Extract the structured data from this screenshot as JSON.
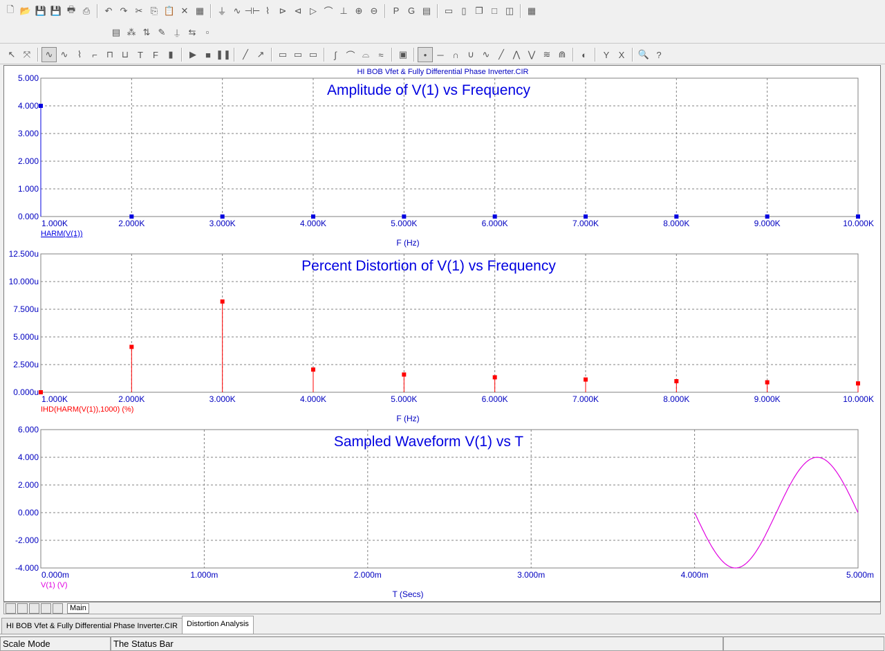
{
  "toolbar": {
    "row1": [
      "new-file",
      "open-file",
      "save",
      "save-all",
      "print",
      "print-preview",
      "undo",
      "redo",
      "cut",
      "copy",
      "paste",
      "delete",
      "select-all",
      "ground",
      "sine-source",
      "capacitor",
      "resistor",
      "diode",
      "transistor",
      "opamp",
      "inductor",
      "battery",
      "npn",
      "pnp",
      "P",
      "G",
      "component-window",
      "tile-horizontal",
      "tile-vertical",
      "cascade",
      "window",
      "split",
      "calculator"
    ],
    "row2": [
      "grid-text",
      "grid-graphics",
      "pin-connection",
      "pen",
      "label",
      "bus",
      "pin"
    ],
    "row3": [
      "select-mode",
      "zoom-mode",
      "scale-mode",
      "cursor-mode",
      "peak",
      "valley",
      "hi",
      "lo",
      "text",
      "fo",
      "graph",
      "run",
      "stop",
      "pause",
      "tangent",
      "slope",
      "wire",
      "bold-wire",
      "dotted",
      "step",
      "rise",
      "fall",
      "spike",
      "data-points",
      "token",
      "band",
      "wave1",
      "wave2",
      "wave3",
      "wave4",
      "wave5",
      "wave6",
      "wave7",
      "wave8",
      "color",
      "same-y",
      "same-x",
      "find",
      "help"
    ]
  },
  "window_title": "HI BOB Vfet & Fully Differential Phase Inverter.CIR",
  "plots": [
    {
      "title": "Amplitude of V(1) vs Frequency",
      "xlabel": "F (Hz)",
      "trace_label": "HARM(V(1))",
      "color": "#0000e0",
      "yticks": [
        "0.000",
        "1.000",
        "2.000",
        "3.000",
        "4.000",
        "5.000"
      ],
      "xticks": [
        "1.000K",
        "2.000K",
        "3.000K",
        "4.000K",
        "5.000K",
        "6.000K",
        "7.000K",
        "8.000K",
        "9.000K",
        "10.000K"
      ]
    },
    {
      "title": "Percent Distortion of V(1) vs Frequency",
      "xlabel": "F (Hz)",
      "trace_label": "IHD(HARM(V(1)),1000) (%)",
      "color": "#ff0000",
      "yticks": [
        "0.000u",
        "2.500u",
        "5.000u",
        "7.500u",
        "10.000u",
        "12.500u"
      ],
      "xticks": [
        "1.000K",
        "2.000K",
        "3.000K",
        "4.000K",
        "5.000K",
        "6.000K",
        "7.000K",
        "8.000K",
        "9.000K",
        "10.000K"
      ]
    },
    {
      "title": "Sampled Waveform  V(1) vs T",
      "xlabel": "T (Secs)",
      "trace_label": "V(1) (V)",
      "color": "#e000e0",
      "yticks": [
        "-4.000",
        "-2.000",
        "0.000",
        "2.000",
        "4.000",
        "6.000"
      ],
      "xticks": [
        "0.000m",
        "1.000m",
        "2.000m",
        "3.000m",
        "4.000m",
        "5.000m"
      ]
    }
  ],
  "chart_data": [
    {
      "type": "bar",
      "title": "Amplitude of V(1) vs Frequency",
      "xlabel": "F (Hz)",
      "series": [
        {
          "name": "HARM(V(1))",
          "x": [
            1000,
            2000,
            3000,
            4000,
            5000,
            6000,
            7000,
            8000,
            9000,
            10000
          ],
          "values": [
            4.0,
            0.0,
            0.0,
            0.0,
            0.0,
            0.0,
            0.0,
            0.0,
            0.0,
            0.0
          ]
        }
      ],
      "xlim": [
        1000,
        10000
      ],
      "ylim": [
        0,
        5
      ],
      "grid": true
    },
    {
      "type": "bar",
      "title": "Percent Distortion of V(1) vs Frequency",
      "xlabel": "F (Hz)",
      "series": [
        {
          "name": "IHD(HARM(V(1)),1000) (%)",
          "x": [
            1000,
            2000,
            3000,
            4000,
            5000,
            6000,
            7000,
            8000,
            9000,
            10000
          ],
          "values": [
            0.0,
            4.1,
            8.2,
            2.05,
            1.6,
            1.35,
            1.15,
            1.0,
            0.9,
            0.8
          ]
        }
      ],
      "xlim": [
        1000,
        10000
      ],
      "ylim": [
        0,
        12.5
      ],
      "y_unit": "u",
      "grid": true
    },
    {
      "type": "line",
      "title": "Sampled Waveform  V(1) vs T",
      "xlabel": "T (Secs)",
      "series": [
        {
          "name": "V(1) (V)",
          "x": [
            4.0,
            4.125,
            4.25,
            4.375,
            4.5,
            4.625,
            4.75,
            4.875,
            5.0
          ],
          "values": [
            0.0,
            -2.83,
            -4.0,
            -2.83,
            0.0,
            2.83,
            4.0,
            2.83,
            0.0
          ]
        }
      ],
      "x_unit": "m",
      "xlim": [
        0,
        5
      ],
      "ylim": [
        -4,
        6
      ],
      "grid": true
    }
  ],
  "bottom": {
    "page_tab": "Main"
  },
  "doc_tabs": [
    "HI BOB Vfet & Fully Differential Phase Inverter.CIR",
    "Distortion Analysis"
  ],
  "status": {
    "mode": "Scale Mode",
    "text": "The Status Bar"
  }
}
